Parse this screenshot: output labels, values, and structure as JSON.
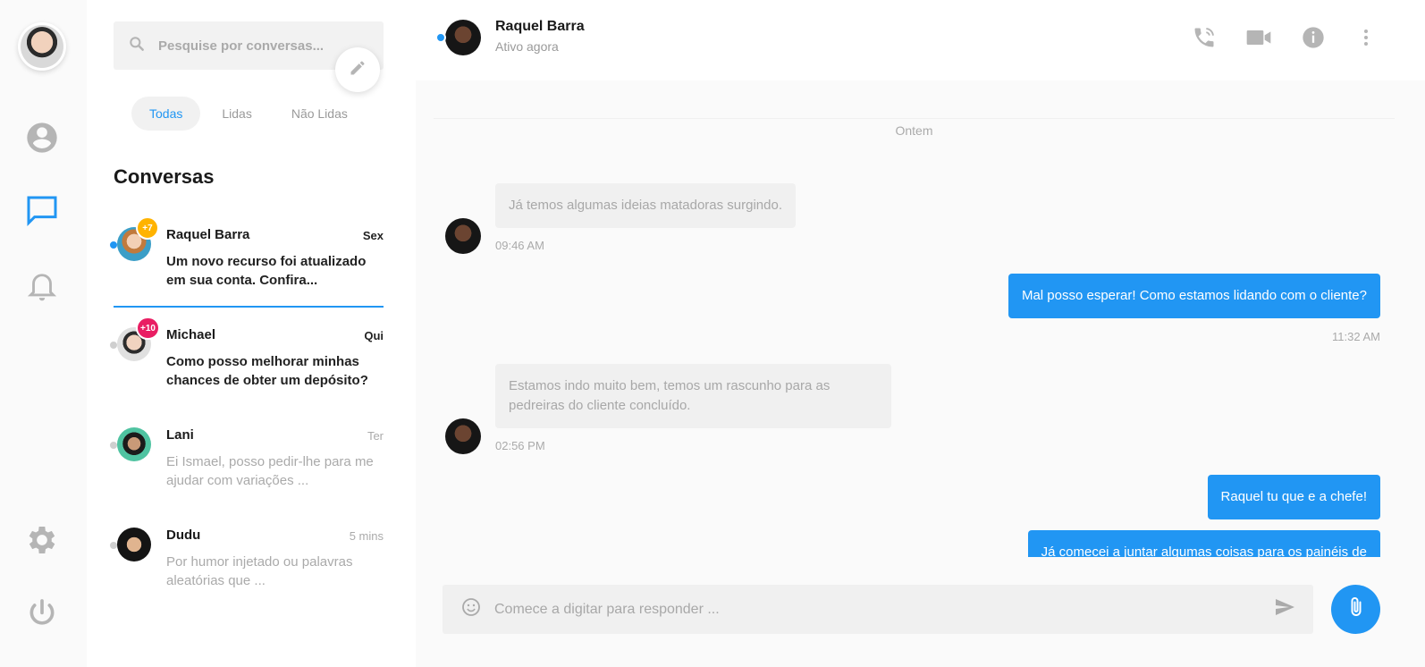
{
  "sidebar": {
    "icons": [
      "user-avatar",
      "profile-icon",
      "chat-icon",
      "bell-icon",
      "moon-icon",
      "gear-icon",
      "power-icon"
    ]
  },
  "search": {
    "placeholder": "Pesquise por conversas..."
  },
  "filters": [
    "Todas",
    "Lidas",
    "Não Lidas"
  ],
  "list": {
    "title": "Conversas",
    "conversations": [
      {
        "name": "Raquel Barra",
        "time": "Sex",
        "preview": "Um novo recurso foi atualizado em sua conta. Confira...",
        "badge": "+7",
        "badge_color": "#ffb300",
        "status_color": "#2196f3",
        "unread": true
      },
      {
        "name": "Michael",
        "time": "Qui",
        "preview": "Como posso melhorar minhas chances de obter um depósito?",
        "badge": "+10",
        "badge_color": "#e91e63",
        "status_color": "#cfcfcf",
        "unread": true
      },
      {
        "name": "Lani",
        "time": "Ter",
        "preview": "Ei Ismael, posso pedir-lhe para me ajudar com variações ...",
        "badge": "",
        "status_color": "#cfcfcf",
        "unread": false
      },
      {
        "name": "Dudu",
        "time": "5 mins",
        "preview": "Por humor injetado ou palavras aleatórias que ...",
        "badge": "",
        "status_color": "#cfcfcf",
        "unread": false
      }
    ]
  },
  "chat": {
    "contact_name": "Raquel Barra",
    "contact_status": "Ativo agora",
    "day_separator": "Ontem",
    "messages": [
      {
        "dir": "in",
        "text": "Já temos algumas ideias matadoras surgindo.",
        "time": "09:46 AM"
      },
      {
        "dir": "out",
        "text": "Mal posso esperar! Como estamos lidando com o cliente?",
        "time": "11:32 AM"
      },
      {
        "dir": "in",
        "text": "Estamos indo muito bem, temos um rascunho para as pedreiras do cliente concluído.",
        "time": "02:56 PM"
      },
      {
        "dir": "out",
        "text": "Raquel tu que e a chefe!",
        "time": ""
      },
      {
        "dir": "out",
        "text": "Já comecei a juntar algumas coisas para os painéis de",
        "time": ""
      }
    ],
    "composer_placeholder": "Comece a digitar para responder ..."
  },
  "colors": {
    "accent": "#2196f3",
    "icon_grey": "#b5b5b5"
  }
}
